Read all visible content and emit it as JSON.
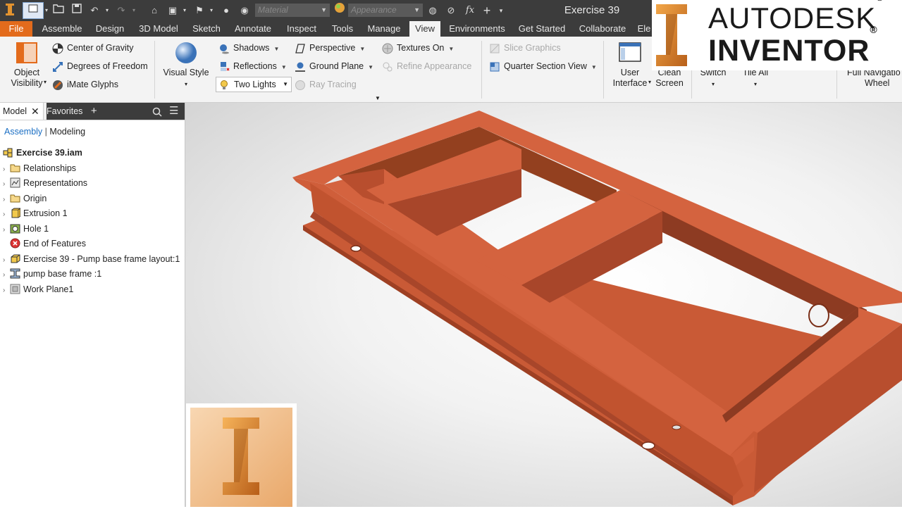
{
  "qat": {
    "material_placeholder": "Material",
    "appearance_placeholder": "Appearance",
    "fx_label": "fx"
  },
  "window_title": "Exercise 39",
  "tabs": [
    "File",
    "Assemble",
    "Design",
    "3D Model",
    "Sketch",
    "Annotate",
    "Inspect",
    "Tools",
    "Manage",
    "View",
    "Environments",
    "Get Started",
    "Collaborate",
    "Ele"
  ],
  "active_tab": "View",
  "ribbon": {
    "object_visibility": [
      "Object",
      "Visibility"
    ],
    "center_of_gravity": "Center of Gravity",
    "degrees_of_freedom": "Degrees of Freedom",
    "imate_glyphs": "iMate Glyphs",
    "visual_style": "Visual Style",
    "shadows": "Shadows",
    "reflections": "Reflections",
    "lighting": "Two Lights",
    "perspective": "Perspective",
    "ground_plane": "Ground Plane",
    "ray_tracing": "Ray Tracing",
    "textures_on": "Textures On",
    "refine_appearance": "Refine Appearance",
    "slice_graphics": "Slice Graphics",
    "quarter_section_view": "Quarter Section View",
    "user_interface": [
      "User",
      "Interface"
    ],
    "clean_screen": [
      "Clean",
      "Screen"
    ],
    "switch": "Switch",
    "tile_all": "Tile All",
    "full_nav_wheel": [
      "Full Navigatio",
      "Wheel"
    ]
  },
  "panel": {
    "tab_model": "Model",
    "tab_favorites": "Favorites",
    "subtab_assembly": "Assembly",
    "subtab_modeling": "Modeling",
    "tree": [
      {
        "label": "Exercise 39.iam",
        "icon": "assembly-icon",
        "root": true
      },
      {
        "label": "Relationships",
        "icon": "folder-icon"
      },
      {
        "label": "Representations",
        "icon": "representations-icon"
      },
      {
        "label": "Origin",
        "icon": "folder-icon"
      },
      {
        "label": "Extrusion 1",
        "icon": "extrusion-icon"
      },
      {
        "label": "Hole 1",
        "icon": "hole-icon"
      },
      {
        "label": "End of Features",
        "icon": "end-of-features-icon"
      },
      {
        "label": "Exercise 39 - Pump base frame layout:1",
        "icon": "part-icon"
      },
      {
        "label": "pump base frame :1",
        "icon": "frame-icon"
      },
      {
        "label": "Work Plane1",
        "icon": "work-plane-icon"
      }
    ]
  },
  "brand": {
    "line1": "AUTODESK",
    "line2": "INVENTOR",
    "reg": "®"
  },
  "colors": {
    "accent": "#e36b1c",
    "frame": "#d4633f",
    "frame_dark": "#b84e2e"
  }
}
